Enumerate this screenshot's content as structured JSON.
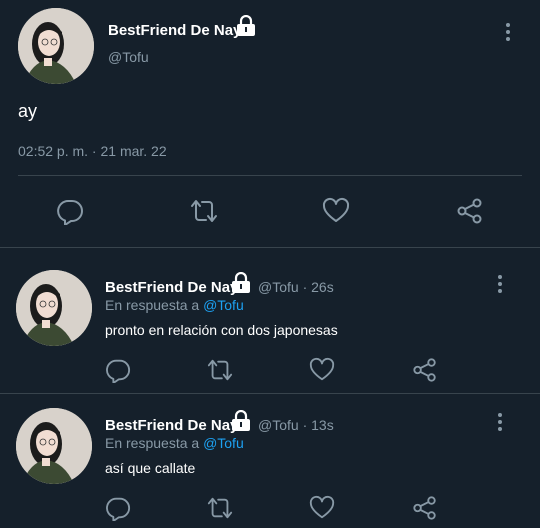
{
  "main_tweet": {
    "display_name": "BestFriend De Nay",
    "handle": "@Tofu",
    "text": "ay",
    "timestamp": "02:52 p. m. · 21 mar. 22"
  },
  "replies": [
    {
      "display_name": "BestFriend De Nay",
      "handle_time": "@Tofu · 26s",
      "reply_prefix": "En respuesta a",
      "reply_to": "@Tofu",
      "text": "pronto en relación con dos japonesas"
    },
    {
      "display_name": "BestFriend De Nay",
      "handle_time": "@Tofu · 13s",
      "reply_prefix": "En respuesta a",
      "reply_to": "@Tofu",
      "text": "así que callate"
    }
  ],
  "icons": {
    "reply": "speech-bubble-icon",
    "retweet": "retweet-icon",
    "like": "heart-icon",
    "share": "share-icon",
    "lock": "lock-icon",
    "more": "more-vertical-icon"
  },
  "colors": {
    "background": "#15202b",
    "text": "#ffffff",
    "muted": "#8899a6",
    "link": "#1da1f2",
    "divider": "#38444d"
  }
}
